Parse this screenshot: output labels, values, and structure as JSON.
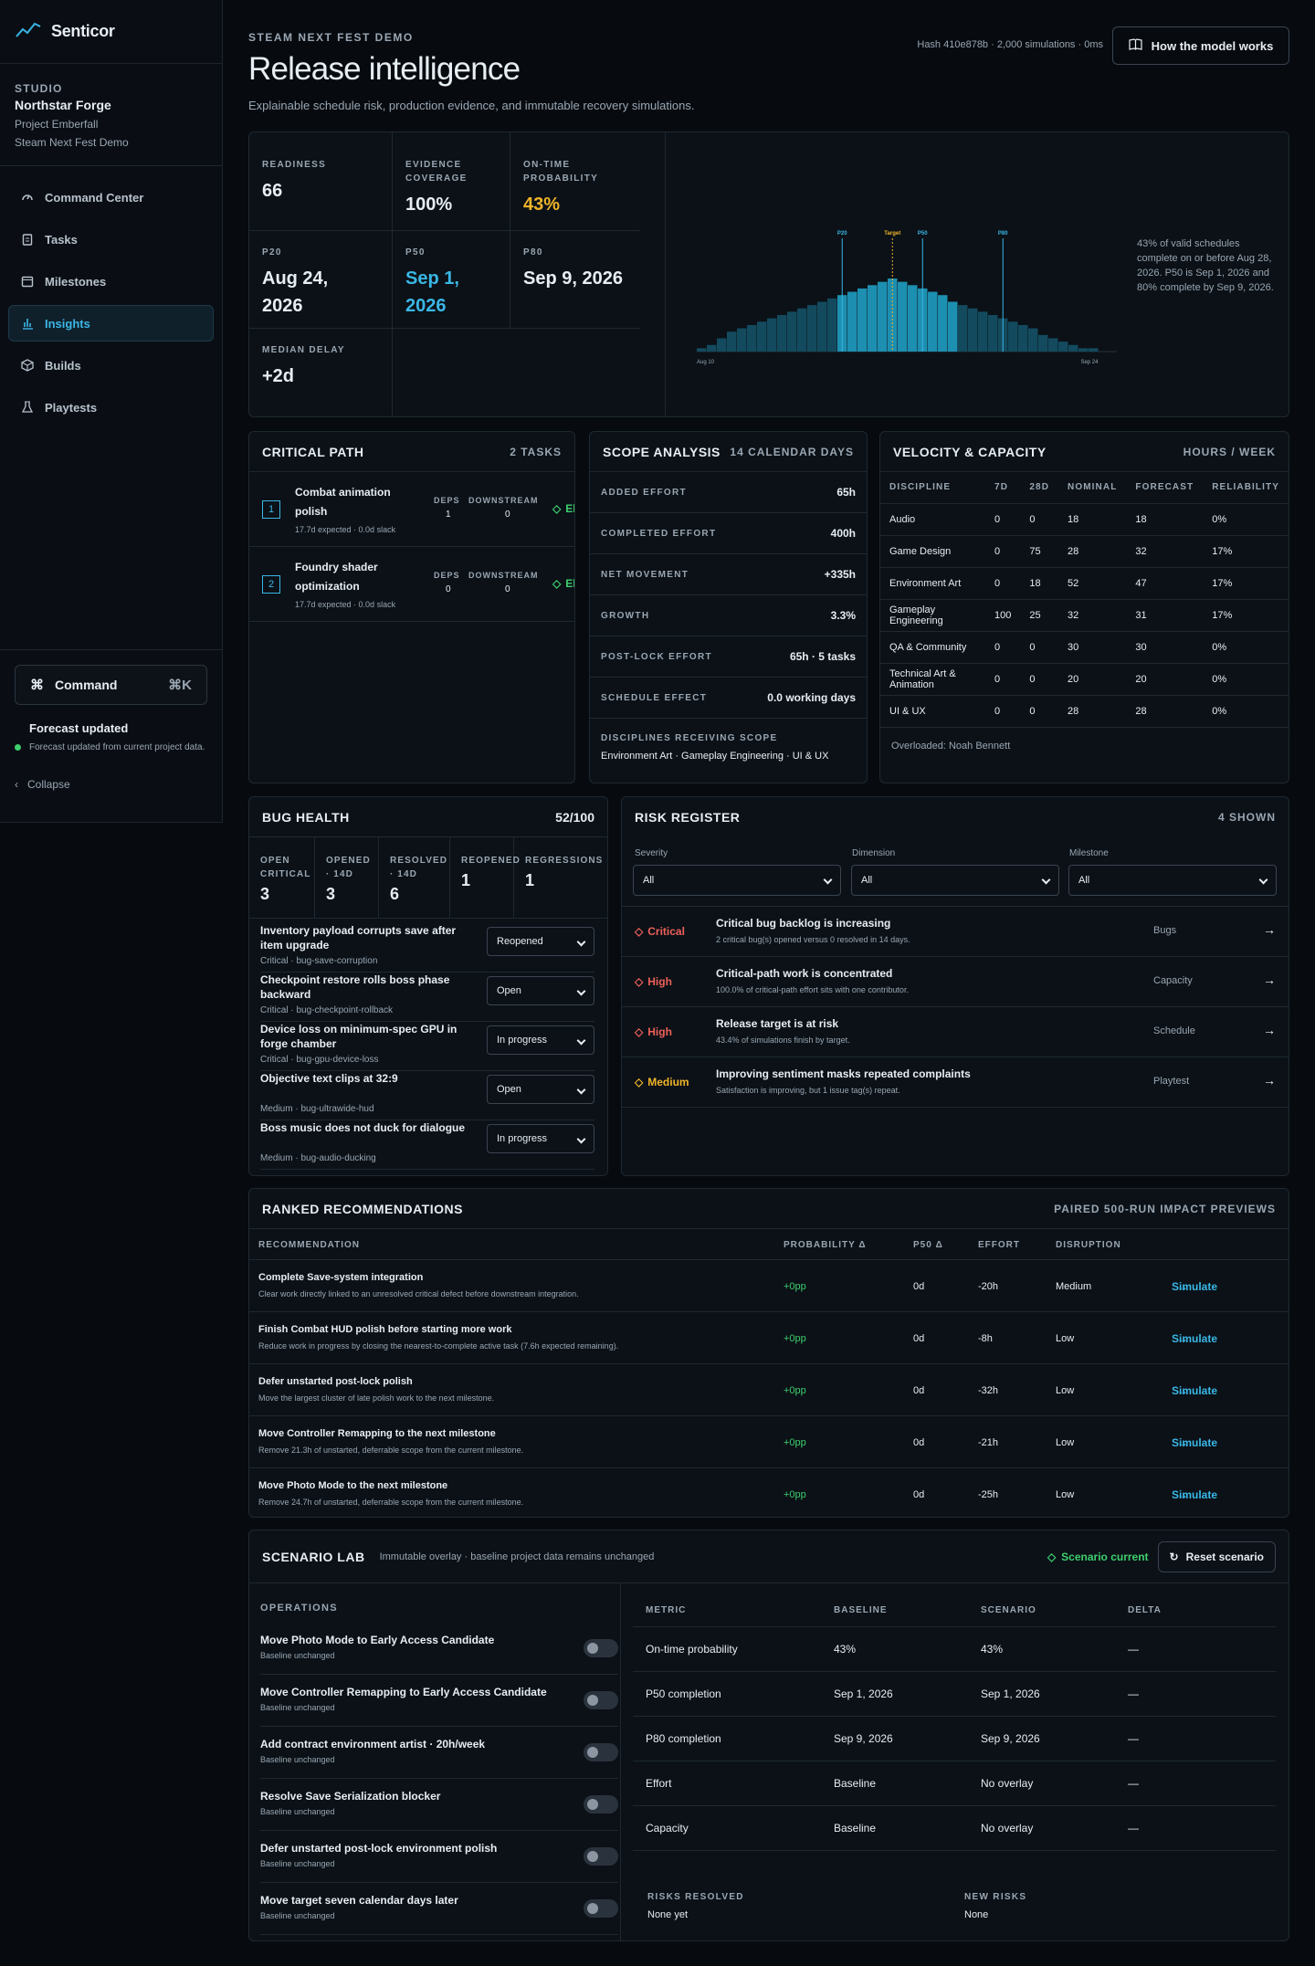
{
  "app": {
    "name": "Senticor"
  },
  "studio": {
    "label": "STUDIO",
    "name": "Northstar Forge",
    "project": "Project Emberfall",
    "milestone": "Steam Next Fest Demo"
  },
  "nav": [
    {
      "label": "Command Center",
      "icon": "gauge-icon"
    },
    {
      "label": "Tasks",
      "icon": "clipboard-icon"
    },
    {
      "label": "Milestones",
      "icon": "calendar-icon"
    },
    {
      "label": "Insights",
      "icon": "bar-chart-icon",
      "active": true
    },
    {
      "label": "Builds",
      "icon": "box-icon"
    },
    {
      "label": "Playtests",
      "icon": "flask-icon"
    }
  ],
  "command": {
    "label": "Command",
    "shortcut": "⌘K"
  },
  "forecast": {
    "title": "Forecast updated",
    "desc": "Forecast updated from current project data."
  },
  "collapse": "Collapse",
  "header": {
    "eyebrow": "STEAM NEXT FEST DEMO",
    "title": "Release intelligence",
    "subtitle": "Explainable schedule risk, production evidence, and immutable recovery simulations.",
    "hash": "Hash 410e878b · 2,000 simulations · 0ms",
    "how": "How the model works"
  },
  "kpis": {
    "readiness": {
      "label": "READINESS",
      "value": "66"
    },
    "evidence": {
      "label": "EVIDENCE COVERAGE",
      "value": "100%"
    },
    "ontime": {
      "label": "ON-TIME PROBABILITY",
      "value": "43%"
    },
    "p20": {
      "label": "P20",
      "value": "Aug 24, 2026"
    },
    "p50": {
      "label": "P50",
      "value": "Sep 1, 2026"
    },
    "p80": {
      "label": "P80",
      "value": "Sep 9, 2026"
    },
    "median": {
      "label": "MEDIAN DELAY",
      "value": "+2d"
    }
  },
  "chart_data": {
    "type": "bar",
    "title": "",
    "xlabel": "",
    "ylabel": "",
    "x_start_label": "Aug 10",
    "x_end_label": "Sep 24",
    "values": [
      1,
      2,
      4,
      6,
      7,
      8,
      9,
      10,
      11,
      12,
      13,
      14,
      15,
      16,
      17,
      18,
      19,
      20,
      21,
      22,
      21,
      20,
      19,
      18,
      17,
      15,
      14,
      13,
      12,
      11,
      10,
      9,
      8,
      7,
      5,
      4,
      3,
      2,
      1,
      1
    ],
    "highlight_range": [
      14,
      25
    ],
    "markers": [
      {
        "label": "P20",
        "index": 14
      },
      {
        "label": "Target",
        "index": 19
      },
      {
        "label": "P50",
        "index": 22
      },
      {
        "label": "P80",
        "index": 30
      }
    ],
    "caption": "43% of valid schedules complete on or before Aug 28, 2026. P50 is Sep 1, 2026 and 80% complete by Sep 9, 2026."
  },
  "critical_path": {
    "title": "CRITICAL PATH",
    "count": "2 TASKS",
    "deps_label": "DEPS",
    "down_label": "DOWNSTREAM",
    "items": [
      {
        "num": "1",
        "name": "Combat animation polish",
        "meta": "17.7d expected · 0.0d slack",
        "deps": "1",
        "down": "0",
        "status": "Eligi"
      },
      {
        "num": "2",
        "name": "Foundry shader optimization",
        "meta": "17.7d expected · 0.0d slack",
        "deps": "0",
        "down": "0",
        "status": "Eligi"
      }
    ]
  },
  "scope": {
    "title": "SCOPE ANALYSIS",
    "right": "14 CALENDAR DAYS",
    "rows": [
      {
        "label": "ADDED EFFORT",
        "value": "65h"
      },
      {
        "label": "COMPLETED EFFORT",
        "value": "400h"
      },
      {
        "label": "NET MOVEMENT",
        "value": "+335h"
      },
      {
        "label": "GROWTH",
        "value": "3.3%"
      },
      {
        "label": "POST-LOCK EFFORT",
        "value": "65h · 5 tasks"
      },
      {
        "label": "SCHEDULE EFFECT",
        "value": "0.0 working days"
      }
    ],
    "disc_label": "DISCIPLINES RECEIVING SCOPE",
    "disc_value": "Environment Art · Gameplay Engineering · UI & UX"
  },
  "velocity": {
    "title": "VELOCITY & CAPACITY",
    "right": "HOURS / WEEK",
    "columns": [
      "DISCIPLINE",
      "7D",
      "28D",
      "NOMINAL",
      "FORECAST",
      "RELIABILITY"
    ],
    "rows": [
      [
        "Audio",
        "0",
        "0",
        "18",
        "18",
        "0%"
      ],
      [
        "Game Design",
        "0",
        "75",
        "28",
        "32",
        "17%"
      ],
      [
        "Environment Art",
        "0",
        "18",
        "52",
        "47",
        "17%"
      ],
      [
        "Gameplay Engineering",
        "100",
        "25",
        "32",
        "31",
        "17%"
      ],
      [
        "QA & Community",
        "0",
        "0",
        "30",
        "30",
        "0%"
      ],
      [
        "Technical Art & Animation",
        "0",
        "0",
        "20",
        "20",
        "0%"
      ],
      [
        "UI & UX",
        "0",
        "0",
        "28",
        "28",
        "0%"
      ]
    ],
    "overloaded": "Overloaded: Noah Bennett"
  },
  "bugs": {
    "title": "BUG HEALTH",
    "score": "52/100",
    "stats": [
      {
        "label": "OPEN CRITICAL",
        "value": "3"
      },
      {
        "label": "OPENED · 14D",
        "value": "3"
      },
      {
        "label": "RESOLVED · 14D",
        "value": "6"
      },
      {
        "label": "REOPENED",
        "value": "1"
      },
      {
        "label": "REGRESSIONS",
        "value": "1"
      }
    ],
    "items": [
      {
        "title": "Inventory payload corrupts save after item upgrade",
        "meta": "Critical · bug-save-corruption",
        "status": "Reopened"
      },
      {
        "title": "Checkpoint restore rolls boss phase backward",
        "meta": "Critical · bug-checkpoint-rollback",
        "status": "Open"
      },
      {
        "title": "Device loss on minimum-spec GPU in forge chamber",
        "meta": "Critical · bug-gpu-device-loss",
        "status": "In progress"
      },
      {
        "title": "Objective text clips at 32:9",
        "meta": "Medium · bug-ultrawide-hud",
        "status": "Open"
      },
      {
        "title": "Boss music does not duck for dialogue",
        "meta": "Medium · bug-audio-ducking",
        "status": "In progress"
      }
    ]
  },
  "risks": {
    "title": "RISK REGISTER",
    "count": "4 SHOWN",
    "filters": [
      {
        "label": "Severity",
        "value": "All"
      },
      {
        "label": "Dimension",
        "value": "All"
      },
      {
        "label": "Milestone",
        "value": "All"
      }
    ],
    "items": [
      {
        "sev": "Critical",
        "color": "#f0605a",
        "title": "Critical bug backlog is increasing",
        "desc": "2 critical bug(s) opened versus 0 resolved in 14 days.",
        "dim": "Bugs"
      },
      {
        "sev": "High",
        "color": "#f0605a",
        "title": "Critical-path work is concentrated",
        "desc": "100.0% of critical-path effort sits with one contributor.",
        "dim": "Capacity"
      },
      {
        "sev": "High",
        "color": "#f0605a",
        "title": "Release target is at risk",
        "desc": "43.4% of simulations finish by target.",
        "dim": "Schedule"
      },
      {
        "sev": "Medium",
        "color": "#f0b429",
        "title": "Improving sentiment masks repeated complaints",
        "desc": "Satisfaction is improving, but 1 issue tag(s) repeat.",
        "dim": "Playtest"
      }
    ]
  },
  "recommendations": {
    "title": "RANKED RECOMMENDATIONS",
    "right": "PAIRED 500-RUN IMPACT PREVIEWS",
    "columns": [
      "RECOMMENDATION",
      "PROBABILITY Δ",
      "P50 Δ",
      "EFFORT",
      "DISRUPTION"
    ],
    "action": "Simulate",
    "items": [
      {
        "title": "Complete Save-system integration",
        "desc": "Clear work directly linked to an unresolved critical defect before downstream integration.",
        "prob": "+0pp",
        "p50": "0d",
        "effort": "-20h",
        "disruption": "Medium"
      },
      {
        "title": "Finish Combat HUD polish before starting more work",
        "desc": "Reduce work in progress by closing the nearest-to-complete active task (7.6h expected remaining).",
        "prob": "+0pp",
        "p50": "0d",
        "effort": "-8h",
        "disruption": "Low"
      },
      {
        "title": "Defer unstarted post-lock polish",
        "desc": "Move the largest cluster of late polish work to the next milestone.",
        "prob": "+0pp",
        "p50": "0d",
        "effort": "-32h",
        "disruption": "Low"
      },
      {
        "title": "Move Controller Remapping to the next milestone",
        "desc": "Remove 21.3h of unstarted, deferrable scope from the current milestone.",
        "prob": "+0pp",
        "p50": "0d",
        "effort": "-21h",
        "disruption": "Low"
      },
      {
        "title": "Move Photo Mode to the next milestone",
        "desc": "Remove 24.7h of unstarted, deferrable scope from the current milestone.",
        "prob": "+0pp",
        "p50": "0d",
        "effort": "-25h",
        "disruption": "Low"
      }
    ]
  },
  "scenario": {
    "title": "SCENARIO LAB",
    "subtitle": "Immutable overlay · baseline project data remains unchanged",
    "status": "Scenario current",
    "reset": "Reset scenario",
    "ops_label": "OPERATIONS",
    "ops": [
      {
        "title": "Move Photo Mode to Early Access Candidate",
        "desc": "Baseline unchanged"
      },
      {
        "title": "Move Controller Remapping to Early Access Candidate",
        "desc": "Baseline unchanged"
      },
      {
        "title": "Add contract environment artist · 20h/week",
        "desc": "Baseline unchanged"
      },
      {
        "title": "Resolve Save Serialization blocker",
        "desc": "Baseline unchanged"
      },
      {
        "title": "Defer unstarted post-lock environment polish",
        "desc": "Baseline unchanged"
      },
      {
        "title": "Move target seven calendar days later",
        "desc": "Baseline unchanged"
      }
    ],
    "columns": [
      "METRIC",
      "BASELINE",
      "SCENARIO",
      "DELTA"
    ],
    "rows": [
      [
        "On-time probability",
        "43%",
        "43%",
        "—"
      ],
      [
        "P50 completion",
        "Sep 1, 2026",
        "Sep 1, 2026",
        "—"
      ],
      [
        "P80 completion",
        "Sep 9, 2026",
        "Sep 9, 2026",
        "—"
      ],
      [
        "Effort",
        "Baseline",
        "No overlay",
        "—"
      ],
      [
        "Capacity",
        "Baseline",
        "No overlay",
        "—"
      ]
    ],
    "resolved_label": "RISKS RESOLVED",
    "resolved_value": "None yet",
    "new_label": "NEW RISKS",
    "new_value": "None"
  }
}
